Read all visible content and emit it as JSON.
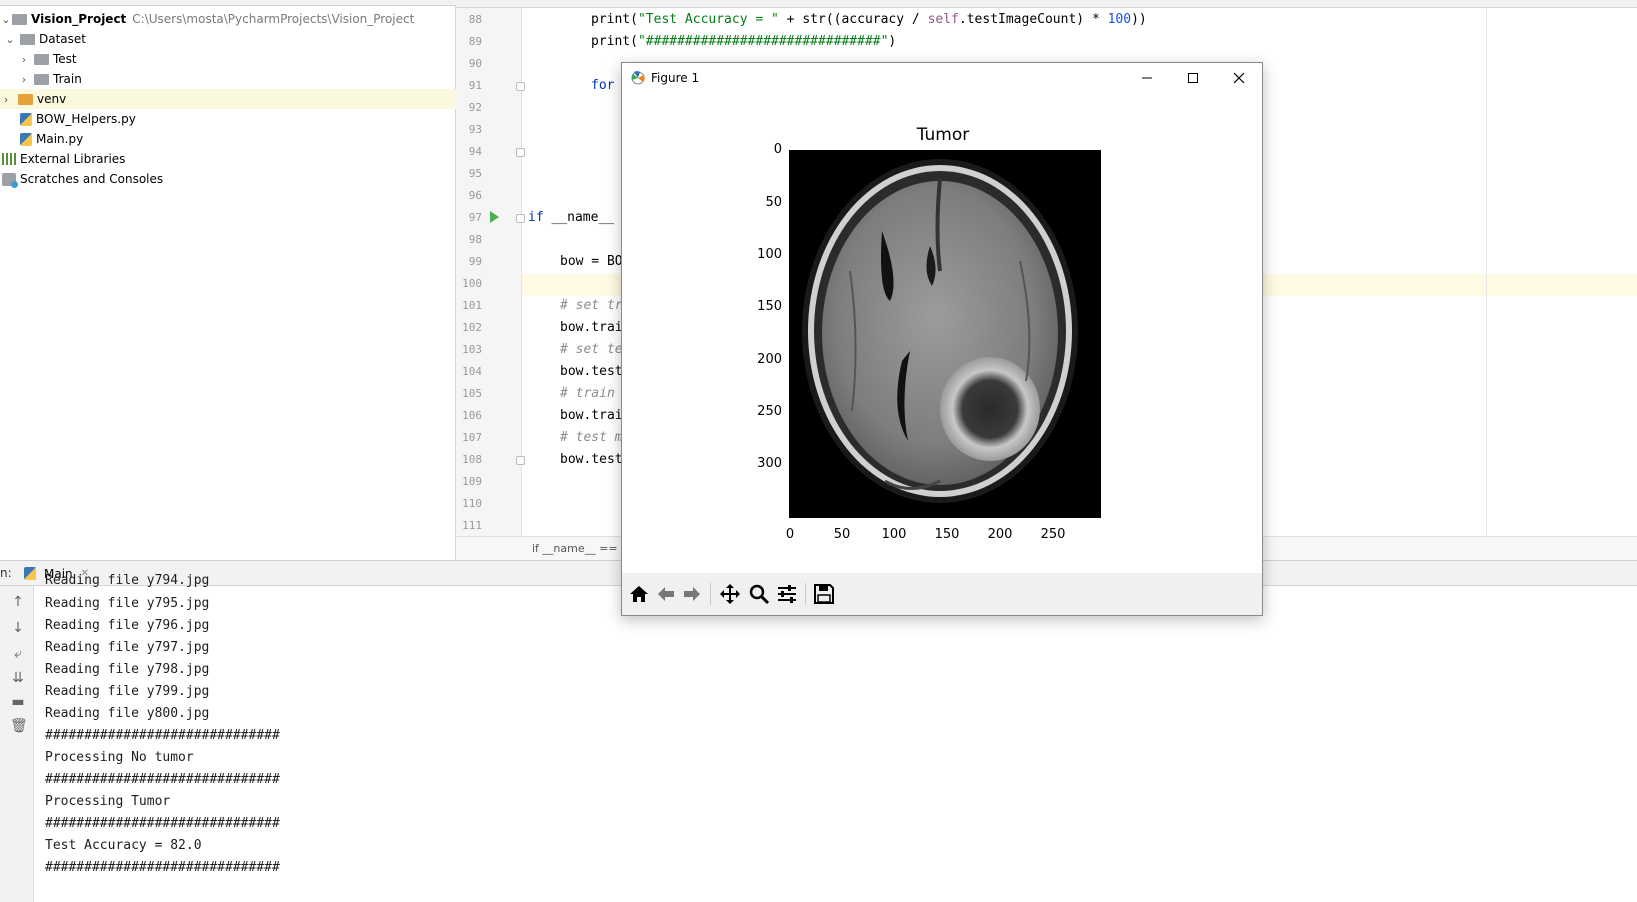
{
  "project": {
    "name": "Vision_Project",
    "path": "C:\\Users\\mosta\\PycharmProjects\\Vision_Project",
    "items": [
      {
        "label": "Dataset"
      },
      {
        "label": "Test"
      },
      {
        "label": "Train"
      },
      {
        "label": "venv"
      },
      {
        "label": "BOW_Helpers.py"
      },
      {
        "label": "Main.py"
      },
      {
        "label": "External Libraries"
      },
      {
        "label": "Scratches and Consoles"
      }
    ]
  },
  "editor": {
    "line_numbers": [
      "88",
      "89",
      "90",
      "91",
      "92",
      "93",
      "94",
      "95",
      "96",
      "97",
      "98",
      "99",
      "100",
      "101",
      "102",
      "103",
      "104",
      "105",
      "106",
      "107",
      "108",
      "109",
      "110",
      "111"
    ],
    "code": {
      "l88_a": "print(",
      "l88_b": "\"Test Accuracy = \"",
      "l88_c": " + str((accuracy / ",
      "l88_d": "self",
      "l88_e": ".testImageCount) * ",
      "l88_f": "100",
      "l88_g": "))",
      "l89_a": "print(",
      "l89_b": "\"##############################\"",
      "l89_c": ")",
      "l91": "for",
      "l97_a": "if",
      "l97_b": " __name__",
      "l99": "bow = BO",
      "l101": "# set tr",
      "l102": "bow.trai",
      "l103": "# set te",
      "l104": "bow.test",
      "l105": "# train",
      "l106": "bow.trai",
      "l107": "# test m",
      "l108": "bow.test"
    },
    "breadcrumb": "if __name__ == '_"
  },
  "run": {
    "tab_prefix": "n:",
    "tab_label": "Main",
    "console_lines": [
      "Reading file y794.jpg",
      "Reading file y795.jpg",
      "Reading file y796.jpg",
      "Reading file y797.jpg",
      "Reading file y798.jpg",
      "Reading file y799.jpg",
      "Reading file y800.jpg",
      "##############################",
      "Processing No tumor",
      "##############################",
      "Processing Tumor",
      "##############################",
      "Test Accuracy = 82.0",
      "##############################"
    ]
  },
  "figure": {
    "window_title": "Figure 1",
    "plot_title": "Tumor",
    "y_ticks": [
      "0",
      "50",
      "100",
      "150",
      "200",
      "250",
      "300"
    ],
    "x_ticks": [
      "0",
      "50",
      "100",
      "150",
      "200",
      "250"
    ],
    "toolbar": [
      "home-icon",
      "back-arrow-icon",
      "forward-arrow-icon",
      "pan-icon",
      "zoom-icon",
      "configure-icon",
      "save-icon"
    ]
  }
}
